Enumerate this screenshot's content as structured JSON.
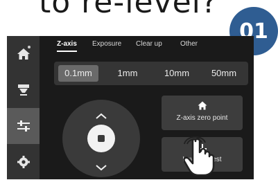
{
  "caption": "to re-level?",
  "step_badge": "01",
  "sidebar": {
    "items": [
      {
        "icon": "home-icon",
        "active": false
      },
      {
        "icon": "print-head-icon",
        "active": false
      },
      {
        "icon": "sliders-icon",
        "active": true
      },
      {
        "icon": "gear-icon",
        "active": false
      }
    ]
  },
  "tabs": [
    {
      "label": "Z-axis",
      "active": true
    },
    {
      "label": "Exposure",
      "active": false
    },
    {
      "label": "Clear up",
      "active": false
    },
    {
      "label": "Other",
      "active": false
    }
  ],
  "step_options": [
    {
      "label": "0.1mm",
      "selected": true
    },
    {
      "label": "1mm",
      "selected": false
    },
    {
      "label": "10mm",
      "selected": false
    },
    {
      "label": "50mm",
      "selected": false
    }
  ],
  "actions": {
    "zero_point_label": "Z-axis zero point",
    "leveling_label": "Leveling test"
  },
  "colors": {
    "badge": "#2f5d92",
    "screen_bg": "#1a1a1a",
    "sidebar_bg": "#333333",
    "sidebar_active": "#5a5a5a",
    "button_bg": "#3d3d3d"
  }
}
